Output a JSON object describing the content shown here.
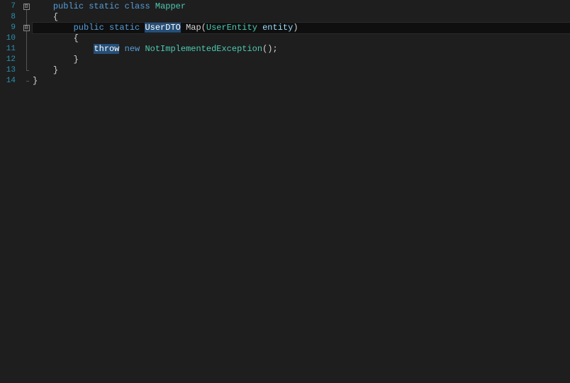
{
  "gutter": {
    "start": 7,
    "end": 14
  },
  "fold": {
    "icons": {
      "line7": "⊟",
      "line9": "⊟"
    }
  },
  "code": {
    "line7": {
      "indent": "    ",
      "kw_public": "public",
      "kw_static": "static",
      "kw_class": "class",
      "type": "Mapper"
    },
    "line8": {
      "indent": "    ",
      "brace": "{"
    },
    "line9": {
      "indent": "        ",
      "kw_public": "public",
      "kw_static": "static",
      "ret_type": "UserDTO",
      "method": "Map",
      "param_type": "UserEntity",
      "param_name": "entity",
      "lp": "(",
      "rp": ")"
    },
    "line10": {
      "indent": "        ",
      "brace": "{"
    },
    "line11": {
      "indent": "            ",
      "kw_throw": "throw",
      "kw_new": "new",
      "type": "NotImplementedException",
      "parens": "()",
      "semi": ";"
    },
    "line12": {
      "indent": "        ",
      "brace": "}"
    },
    "line13": {
      "indent": "    ",
      "brace": "}"
    },
    "line14": {
      "brace": "}"
    }
  }
}
